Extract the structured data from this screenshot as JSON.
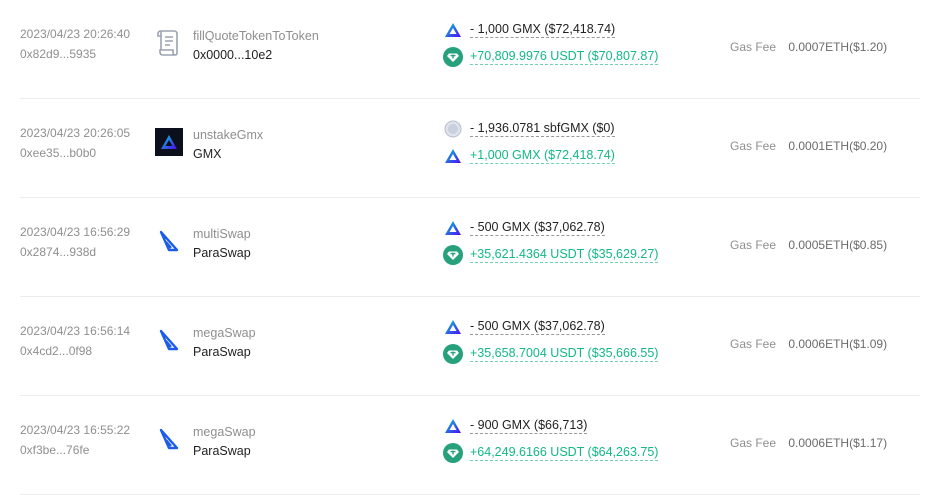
{
  "fee_label": "Gas Fee",
  "colors": {
    "positive": "#12b886",
    "gmx_blue": "#2d42fc",
    "paraswap_blue": "#1b5ce8",
    "usdt_teal": "#26a17b"
  },
  "transactions": [
    {
      "time": "2023/04/23 20:26:40",
      "hash": "0x82d9...5935",
      "protocol_icon": "document-icon",
      "method": "fillQuoteTokenToToken",
      "target": "0x0000...10e2",
      "transfers": [
        {
          "icon": "gmx-icon",
          "amount": "- 1,000 GMX ($72,418.74)",
          "direction": "out"
        },
        {
          "icon": "usdt-icon",
          "amount": "+70,809.9976 USDT ($70,807.87)",
          "direction": "in"
        }
      ],
      "fee": "0.0007ETH($1.20)"
    },
    {
      "time": "2023/04/23 20:26:05",
      "hash": "0xee35...b0b0",
      "protocol_icon": "gmx-logo-icon",
      "method": "unstakeGmx",
      "target": "GMX",
      "transfers": [
        {
          "icon": "sbfgmx-icon",
          "amount": "- 1,936.0781 sbfGMX ($0)",
          "direction": "out"
        },
        {
          "icon": "gmx-icon",
          "amount": "+1,000 GMX ($72,418.74)",
          "direction": "in"
        }
      ],
      "fee": "0.0001ETH($0.20)"
    },
    {
      "time": "2023/04/23 16:56:29",
      "hash": "0x2874...938d",
      "protocol_icon": "paraswap-icon",
      "method": "multiSwap",
      "target": "ParaSwap",
      "transfers": [
        {
          "icon": "gmx-icon",
          "amount": "- 500 GMX ($37,062.78)",
          "direction": "out"
        },
        {
          "icon": "usdt-icon",
          "amount": "+35,621.4364 USDT ($35,629.27)",
          "direction": "in"
        }
      ],
      "fee": "0.0005ETH($0.85)"
    },
    {
      "time": "2023/04/23 16:56:14",
      "hash": "0x4cd2...0f98",
      "protocol_icon": "paraswap-icon",
      "method": "megaSwap",
      "target": "ParaSwap",
      "transfers": [
        {
          "icon": "gmx-icon",
          "amount": "- 500 GMX ($37,062.78)",
          "direction": "out"
        },
        {
          "icon": "usdt-icon",
          "amount": "+35,658.7004 USDT ($35,666.55)",
          "direction": "in"
        }
      ],
      "fee": "0.0006ETH($1.09)"
    },
    {
      "time": "2023/04/23 16:55:22",
      "hash": "0xf3be...76fe",
      "protocol_icon": "paraswap-icon",
      "method": "megaSwap",
      "target": "ParaSwap",
      "transfers": [
        {
          "icon": "gmx-icon",
          "amount": "- 900 GMX ($66,713)",
          "direction": "out"
        },
        {
          "icon": "usdt-icon",
          "amount": "+64,249.6166 USDT ($64,263.75)",
          "direction": "in"
        }
      ],
      "fee": "0.0006ETH($1.17)"
    }
  ]
}
